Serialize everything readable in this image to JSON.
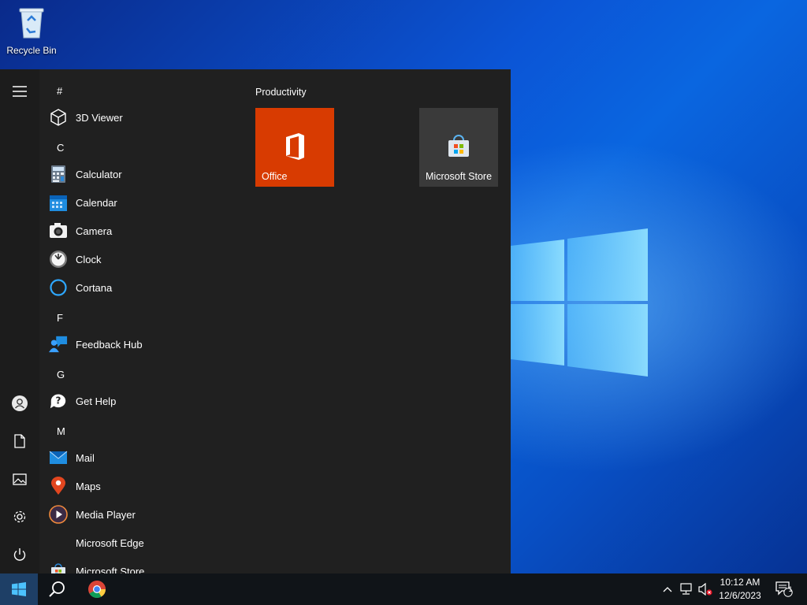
{
  "desktop": {
    "recycle_bin_label": "Recycle Bin"
  },
  "start_menu": {
    "sections": [
      {
        "letter": "#",
        "apps": [
          {
            "label": "3D Viewer",
            "icon": "cube-icon"
          }
        ]
      },
      {
        "letter": "C",
        "apps": [
          {
            "label": "Calculator",
            "icon": "calculator-icon"
          },
          {
            "label": "Calendar",
            "icon": "calendar-icon"
          },
          {
            "label": "Camera",
            "icon": "camera-icon"
          },
          {
            "label": "Clock",
            "icon": "clock-icon"
          },
          {
            "label": "Cortana",
            "icon": "cortana-icon"
          }
        ]
      },
      {
        "letter": "F",
        "apps": [
          {
            "label": "Feedback Hub",
            "icon": "feedback-icon"
          }
        ]
      },
      {
        "letter": "G",
        "apps": [
          {
            "label": "Get Help",
            "icon": "help-icon"
          }
        ]
      },
      {
        "letter": "M",
        "apps": [
          {
            "label": "Mail",
            "icon": "mail-icon"
          },
          {
            "label": "Maps",
            "icon": "map-pin-icon"
          },
          {
            "label": "Media Player",
            "icon": "play-icon"
          },
          {
            "label": "Microsoft Edge",
            "icon": ""
          },
          {
            "label": "Microsoft Store",
            "icon": "store-icon"
          }
        ]
      }
    ],
    "tile_group_title": "Productivity",
    "tiles": [
      {
        "label": "Office",
        "color": "#d83b01"
      },
      {
        "label": "Microsoft Store",
        "color": "#3a3a3a"
      }
    ],
    "rail_icons": [
      "hamburger-icon",
      "user-icon",
      "document-icon",
      "pictures-icon",
      "settings-icon",
      "power-icon"
    ]
  },
  "taskbar": {
    "time": "10:12 AM",
    "date": "12/6/2023",
    "notification_count": "1"
  },
  "colors": {
    "start_bg": "#202020",
    "taskbar_bg": "#101418",
    "office_tile": "#d83b01",
    "accent": "#0078d7"
  }
}
